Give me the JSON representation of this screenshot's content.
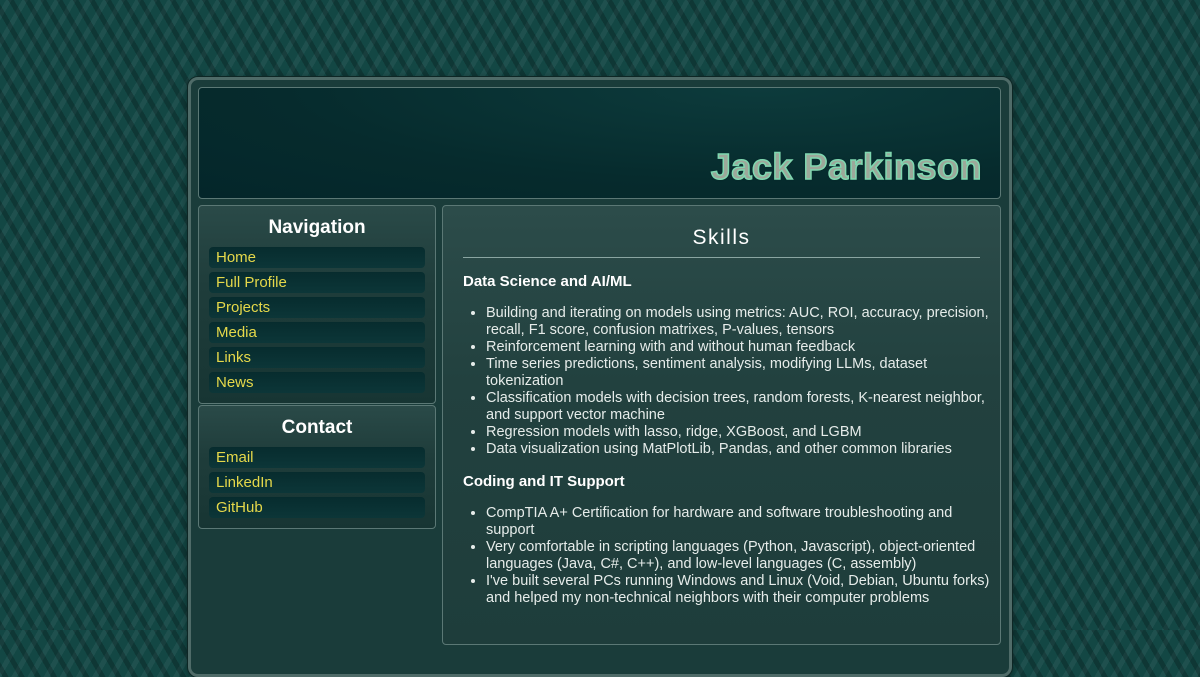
{
  "header": {
    "title": "Jack Parkinson"
  },
  "navigation": {
    "title": "Navigation",
    "items": [
      "Home",
      "Full Profile",
      "Projects",
      "Media",
      "Links",
      "News"
    ]
  },
  "contact": {
    "title": "Contact",
    "items": [
      "Email",
      "LinkedIn",
      "GitHub"
    ]
  },
  "content": {
    "title": "Skills",
    "sections": [
      {
        "heading": "Data Science and AI/ML",
        "items": [
          "Building and iterating on models using metrics: AUC, ROI, accuracy, precision, recall, F1 score, confusion matrixes, P-values, tensors",
          "Reinforcement learning with and without human feedback",
          "Time series predictions, sentiment analysis, modifying LLMs, dataset tokenization",
          "Classification models with decision trees, random forests, K-nearest neighbor, and support vector machine",
          "Regression models with lasso, ridge, XGBoost, and LGBM",
          "Data visualization using MatPlotLib, Pandas, and other common libraries"
        ]
      },
      {
        "heading": "Coding and IT Support",
        "items": [
          "CompTIA A+ Certification for hardware and software troubleshooting and support",
          "Very comfortable in scripting languages (Python, Javascript), object-oriented languages (Java, C#, C++), and low-level languages (C, assembly)",
          "I've built several PCs running Windows and Linux (Void, Debian, Ubuntu forks) and helped my non-technical neighbors with their computer problems"
        ]
      }
    ]
  },
  "colors": {
    "background": "#134744",
    "nav_link": "#e5d84a",
    "title_outline": "#7fd7b0"
  }
}
